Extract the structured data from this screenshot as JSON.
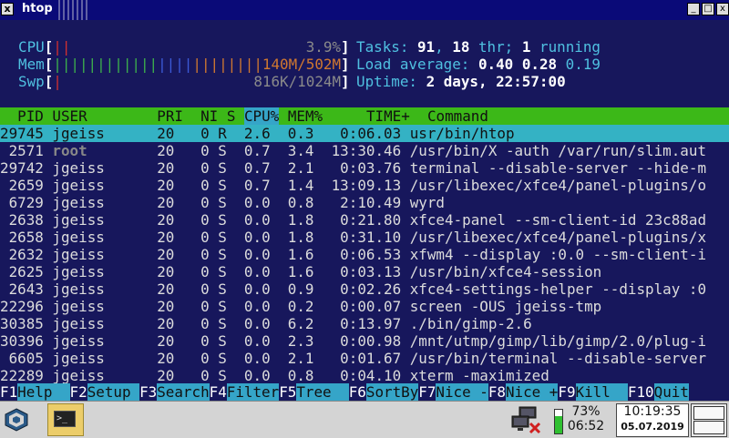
{
  "window": {
    "title": "htop",
    "close_glyph": "x",
    "min_glyph": "_",
    "max_glyph": "□",
    "close2_glyph": "x"
  },
  "meters": {
    "cpu": {
      "label": "CPU",
      "bar": "||",
      "value": "3.9%"
    },
    "mem": {
      "label": "Mem",
      "bar_green": "||||||||||||",
      "bar_blue": "||||",
      "bar_orange": "||||||||",
      "value": "140M/502M"
    },
    "swp": {
      "label": "Swp",
      "bar": "|",
      "value": "816K/1024M"
    }
  },
  "stats": {
    "tasks_label": "Tasks:",
    "tasks": "91",
    "thr": "18",
    "thr_label": "thr;",
    "running": "1",
    "running_label": "running",
    "load_label": "Load average:",
    "load1": "0.40",
    "load5": "0.28",
    "load15": "0.19",
    "uptime_label": "Uptime:",
    "uptime": "2 days, 22:57:00"
  },
  "columns": {
    "pid": "PID",
    "user": "USER",
    "pri": "PRI",
    "ni": "NI",
    "s": "S",
    "cpu": "CPU%",
    "mem": "MEM%",
    "time": "TIME+",
    "command": "Command"
  },
  "processes": [
    {
      "pid": "29745",
      "user": "jgeiss",
      "pri": "20",
      "ni": "0",
      "s": "R",
      "cpu": "2.6",
      "mem": "0.3",
      "time": "0:06.03",
      "cmd": "usr/bin/htop"
    },
    {
      "pid": "2571",
      "user": "root",
      "pri": "20",
      "ni": "0",
      "s": "S",
      "cpu": "0.7",
      "mem": "3.4",
      "time": "13:30.46",
      "cmd": "/usr/bin/X -auth /var/run/slim.aut"
    },
    {
      "pid": "29742",
      "user": "jgeiss",
      "pri": "20",
      "ni": "0",
      "s": "S",
      "cpu": "0.7",
      "mem": "2.1",
      "time": "0:03.76",
      "cmd": "terminal --disable-server --hide-m"
    },
    {
      "pid": "2659",
      "user": "jgeiss",
      "pri": "20",
      "ni": "0",
      "s": "S",
      "cpu": "0.7",
      "mem": "1.4",
      "time": "13:09.13",
      "cmd": "/usr/libexec/xfce4/panel-plugins/o"
    },
    {
      "pid": "6729",
      "user": "jgeiss",
      "pri": "20",
      "ni": "0",
      "s": "S",
      "cpu": "0.0",
      "mem": "0.8",
      "time": "2:10.49",
      "cmd": "wyrd"
    },
    {
      "pid": "2638",
      "user": "jgeiss",
      "pri": "20",
      "ni": "0",
      "s": "S",
      "cpu": "0.0",
      "mem": "1.8",
      "time": "0:21.80",
      "cmd": "xfce4-panel --sm-client-id 23c88ad"
    },
    {
      "pid": "2658",
      "user": "jgeiss",
      "pri": "20",
      "ni": "0",
      "s": "S",
      "cpu": "0.0",
      "mem": "1.8",
      "time": "0:31.10",
      "cmd": "/usr/libexec/xfce4/panel-plugins/x"
    },
    {
      "pid": "2632",
      "user": "jgeiss",
      "pri": "20",
      "ni": "0",
      "s": "S",
      "cpu": "0.0",
      "mem": "1.6",
      "time": "0:06.53",
      "cmd": "xfwm4 --display :0.0 --sm-client-i"
    },
    {
      "pid": "2625",
      "user": "jgeiss",
      "pri": "20",
      "ni": "0",
      "s": "S",
      "cpu": "0.0",
      "mem": "1.6",
      "time": "0:03.13",
      "cmd": "/usr/bin/xfce4-session"
    },
    {
      "pid": "2643",
      "user": "jgeiss",
      "pri": "20",
      "ni": "0",
      "s": "S",
      "cpu": "0.0",
      "mem": "0.9",
      "time": "0:02.26",
      "cmd": "xfce4-settings-helper --display :0"
    },
    {
      "pid": "22296",
      "user": "jgeiss",
      "pri": "20",
      "ni": "0",
      "s": "S",
      "cpu": "0.0",
      "mem": "0.2",
      "time": "0:00.07",
      "cmd": "screen -OUS jgeiss-tmp"
    },
    {
      "pid": "30385",
      "user": "jgeiss",
      "pri": "20",
      "ni": "0",
      "s": "S",
      "cpu": "0.0",
      "mem": "6.2",
      "time": "0:13.97",
      "cmd": "./bin/gimp-2.6"
    },
    {
      "pid": "30396",
      "user": "jgeiss",
      "pri": "20",
      "ni": "0",
      "s": "S",
      "cpu": "0.0",
      "mem": "2.3",
      "time": "0:00.98",
      "cmd": "/mnt/utmp/gimp/lib/gimp/2.0/plug-i"
    },
    {
      "pid": "6605",
      "user": "jgeiss",
      "pri": "20",
      "ni": "0",
      "s": "S",
      "cpu": "0.0",
      "mem": "2.1",
      "time": "0:01.67",
      "cmd": "/usr/bin/terminal --disable-server"
    },
    {
      "pid": "22289",
      "user": "jgeiss",
      "pri": "20",
      "ni": "0",
      "s": "S",
      "cpu": "0.0",
      "mem": "0.8",
      "time": "0:04.10",
      "cmd": "xterm -maximized"
    }
  ],
  "fkeys": [
    {
      "key": "F1",
      "label": "Help  "
    },
    {
      "key": "F2",
      "label": "Setup "
    },
    {
      "key": "F3",
      "label": "Search"
    },
    {
      "key": "F4",
      "label": "Filter"
    },
    {
      "key": "F5",
      "label": "Tree  "
    },
    {
      "key": "F6",
      "label": "SortBy"
    },
    {
      "key": "F7",
      "label": "Nice -"
    },
    {
      "key": "F8",
      "label": "Nice +"
    },
    {
      "key": "F9",
      "label": "Kill  "
    },
    {
      "key": "F10",
      "label": "Quit"
    }
  ],
  "taskbar": {
    "battery_percent": "73%",
    "battery_time": "06:52",
    "battery_level": 0.73,
    "clock_time": "10:19:35",
    "clock_date": "05.07.2019",
    "terminal_prompt": ">_",
    "icons": {
      "menu": "menu-cube-icon",
      "terminal": "terminal-icon",
      "network": "network-disconnected-icon",
      "battery": "battery-icon"
    },
    "colors": {
      "battery_fill": "#2fc030",
      "terminal_button": "#eccd6a"
    }
  }
}
